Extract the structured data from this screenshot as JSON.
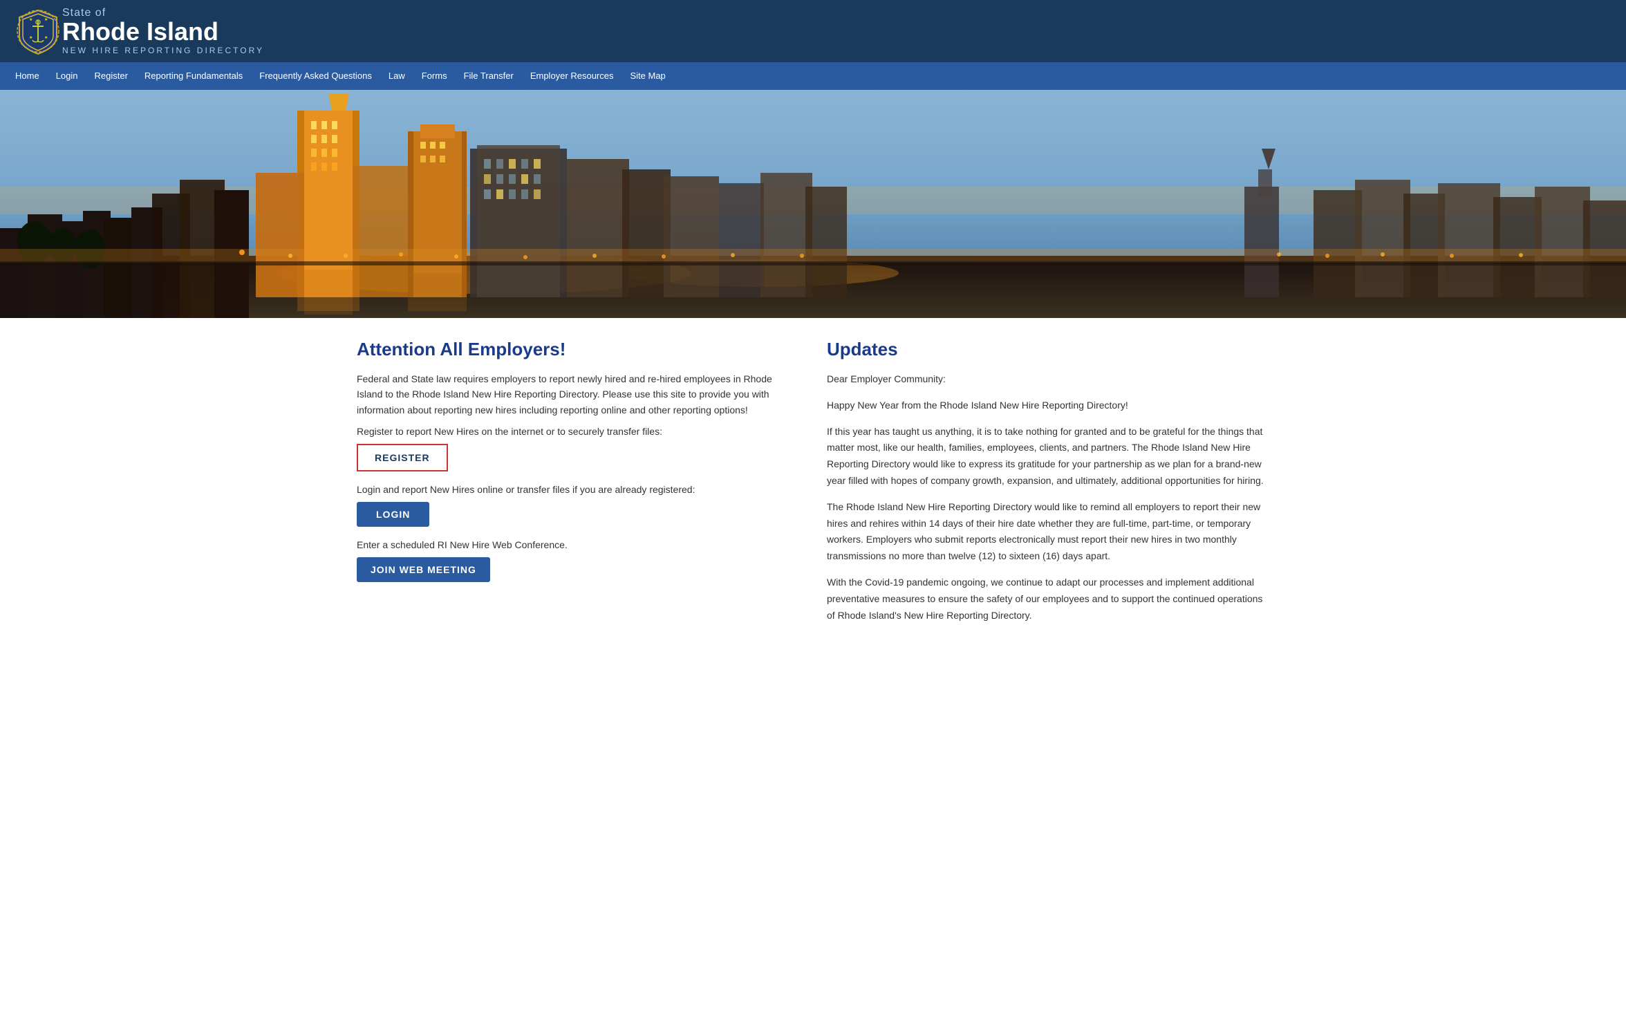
{
  "header": {
    "state_label": "State of",
    "title": "Rhode Island",
    "subtitle": "NEW HIRE REPORTING DIRECTORY"
  },
  "nav": {
    "items": [
      {
        "label": "Home",
        "id": "home"
      },
      {
        "label": "Login",
        "id": "login"
      },
      {
        "label": "Register",
        "id": "register"
      },
      {
        "label": "Reporting Fundamentals",
        "id": "reporting-fundamentals"
      },
      {
        "label": "Frequently Asked Questions",
        "id": "faq"
      },
      {
        "label": "Law",
        "id": "law"
      },
      {
        "label": "Forms",
        "id": "forms"
      },
      {
        "label": "File Transfer",
        "id": "file-transfer"
      },
      {
        "label": "Employer Resources",
        "id": "employer-resources"
      },
      {
        "label": "Site Map",
        "id": "site-map"
      }
    ]
  },
  "left": {
    "title": "Attention All Employers!",
    "body1": "Federal and State law requires employers to report newly hired and re-hired employees in Rhode Island to the Rhode Island New Hire Reporting Directory. Please use this site to provide you with information about reporting new hires including reporting online and other reporting options!",
    "register_label": "Register to report New Hires on the internet or to securely transfer files:",
    "register_btn": "REGISTER",
    "login_label": "Login and report New Hires online or transfer files if you are already registered:",
    "login_btn": "LOGIN",
    "join_label": "Enter a scheduled RI New Hire Web Conference.",
    "join_btn": "JOIN WEB MEETING"
  },
  "right": {
    "title": "Updates",
    "p1": "Dear Employer Community:",
    "p2": "Happy New Year from the Rhode Island New Hire Reporting Directory!",
    "p3": "If this year has taught us anything, it is to take nothing for granted and to be grateful for the things that matter most, like our health, families, employees, clients, and partners. The Rhode Island New Hire Reporting Directory would like to express its gratitude for your partnership as we plan for a brand-new year filled with hopes of company growth, expansion, and ultimately, additional opportunities for hiring.",
    "p4": "The Rhode Island New Hire Reporting Directory would like to remind all employers to report their new hires and rehires within 14 days of their hire date whether they are full-time, part-time, or temporary workers. Employers who submit reports electronically must report their new hires in two monthly transmissions no more than twelve (12) to sixteen (16) days apart.",
    "p5": "With the Covid-19 pandemic ongoing, we continue to adapt our processes and implement additional preventative measures to ensure the safety of our employees and to support the continued operations of Rhode Island's New Hire Reporting Directory."
  },
  "colors": {
    "header_bg": "#1a3a5c",
    "nav_bg": "#2a5a9f",
    "title_color": "#1a3a8a",
    "register_border": "#cc3333"
  }
}
